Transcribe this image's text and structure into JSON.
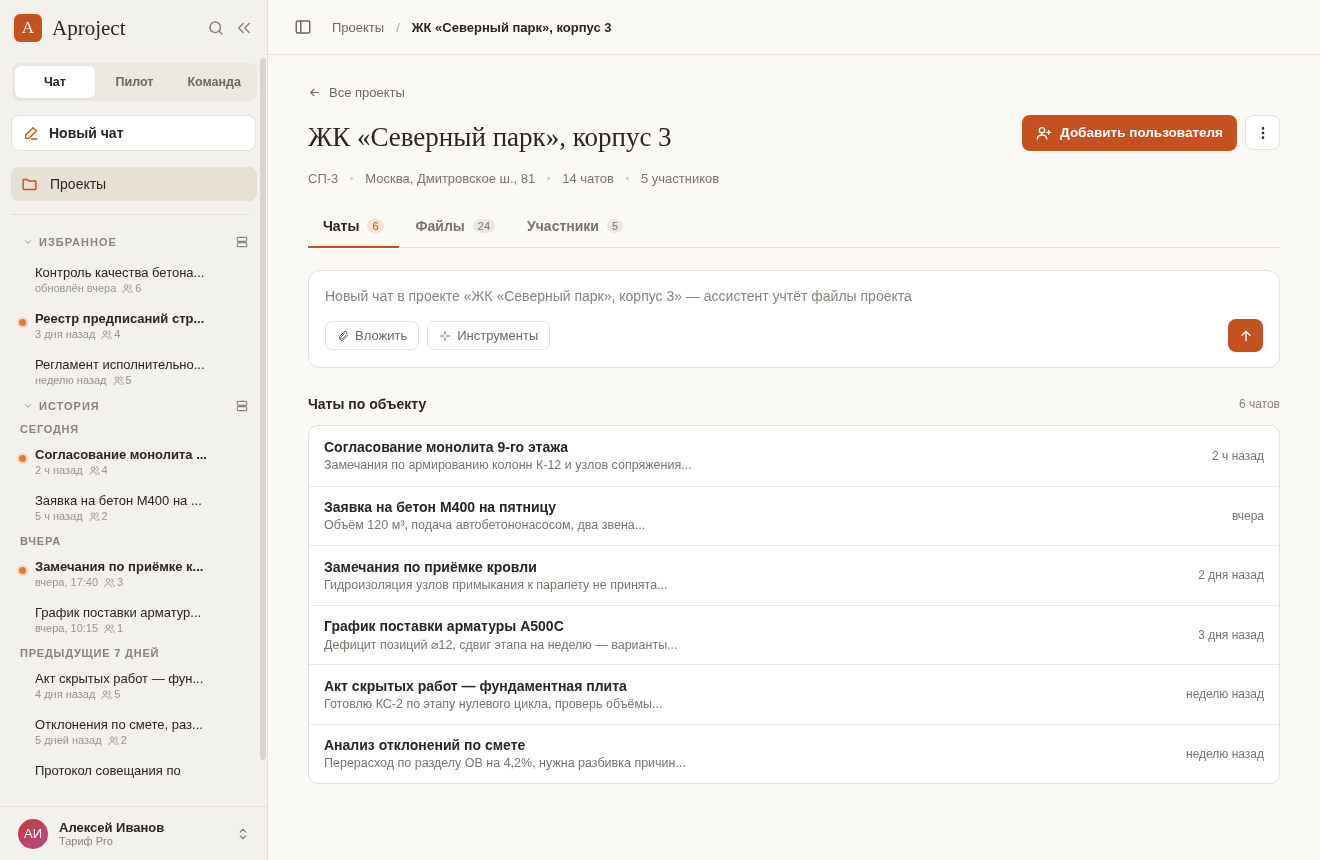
{
  "sidebar": {
    "logo": {
      "letter": "A",
      "name": "Aproject"
    },
    "mode_tabs": [
      {
        "label": "Чат",
        "selected": true
      },
      {
        "label": "Пилот",
        "selected": false
      },
      {
        "label": "Команда",
        "selected": false
      }
    ],
    "new_chat": "Новый чат",
    "nav": [
      {
        "label": "Проекты",
        "selected": true
      }
    ],
    "sections": [
      {
        "title": "ИЗБРАННОЕ",
        "expanded": true,
        "groups": [
          {
            "items": [
              {
                "title": "Контроль качества бетона...",
                "meta": "обновлён вчера",
                "members": "6",
                "unread": false
              },
              {
                "title": "Реестр предписаний стр...",
                "meta": "3 дня назад",
                "members": "4",
                "unread": true
              },
              {
                "title": "Регламент исполнительно...",
                "meta": "неделю назад",
                "members": "5",
                "unread": false
              }
            ]
          }
        ]
      },
      {
        "title": "ИСТОРИЯ",
        "expanded": true,
        "groups": [
          {
            "label": "СЕГОДНЯ",
            "items": [
              {
                "title": "Согласование монолита ...",
                "meta": "2 ч назад",
                "members": "4",
                "unread": true
              },
              {
                "title": "Заявка на бетон М400 на ...",
                "meta": "5 ч назад",
                "members": "2",
                "unread": false
              }
            ]
          },
          {
            "label": "ВЧЕРА",
            "items": [
              {
                "title": "Замечания по приёмке к...",
                "meta": "вчера, 17:40",
                "members": "3",
                "unread": true
              },
              {
                "title": "График поставки арматур...",
                "meta": "вчера, 10:15",
                "members": "1",
                "unread": false
              }
            ]
          },
          {
            "label": "ПРЕДЫДУЩИЕ 7 ДНЕЙ",
            "items": [
              {
                "title": "Акт скрытых работ — фун...",
                "meta": "4 дня назад",
                "members": "5",
                "unread": false
              },
              {
                "title": "Отклонения по смете, раз...",
                "meta": "5 дней назад",
                "members": "2",
                "unread": false
              },
              {
                "title": "Протокол совещания по",
                "unread": false
              }
            ]
          }
        ]
      }
    ],
    "user": {
      "initials": "АИ",
      "name": "Алексей Иванов",
      "plan": "Тариф Pro"
    }
  },
  "breadcrumb": [
    {
      "label": "Проекты",
      "current": false
    },
    {
      "separator": "/",
      "label": "ЖК «Северный парк», корпус 3",
      "current": true
    }
  ],
  "back_link": "Все проекты",
  "title": "ЖК «Северный парк», корпус 3",
  "add_user_button": "Добавить пользователя",
  "meta": [
    "СП-3",
    "Москва, Дмитровское ш., 81",
    "14 чатов",
    "5 участников"
  ],
  "tabs": [
    {
      "label": "Чаты",
      "count": "6",
      "selected": true
    },
    {
      "label": "Файлы",
      "count": "24",
      "selected": false
    },
    {
      "label": "Участники",
      "count": "5",
      "selected": false
    }
  ],
  "composer": {
    "placeholder": "Новый чат в проекте «ЖК «Северный парк», корпус 3» — ассистент учтёт файлы проекта",
    "buttons": [
      {
        "kind": "attach",
        "label": "Вложить"
      },
      {
        "kind": "tools",
        "label": "Инструменты"
      }
    ]
  },
  "chats": {
    "title": "Чаты по объекту",
    "count": "6 чатов",
    "rows": [
      {
        "title": "Согласование монолита 9-го этажа",
        "preview": "Замечания по армированию колонн К-12 и узлов сопряжения...",
        "time": "2 ч назад"
      },
      {
        "title": "Заявка на бетон М400 на пятницу",
        "preview": "Объём 120 м³, подача автобетононасосом, два звена...",
        "time": "вчера"
      },
      {
        "title": "Замечания по приёмке кровли",
        "preview": "Гидроизоляция узлов примыкания к парапету не принята...",
        "time": "2 дня назад"
      },
      {
        "title": "График поставки арматуры А500С",
        "preview": "Дефицит позиций ⌀12, сдвиг этапа на неделю — варианты...",
        "time": "3 дня назад"
      },
      {
        "title": "Акт скрытых работ — фундаментная плита",
        "preview": "Готовлю КС-2 по этапу нулевого цикла, проверь объёмы...",
        "time": "неделю назад"
      },
      {
        "title": "Анализ отклонений по смете",
        "preview": "Перерасход по разделу ОВ на 4,2%, нужна разбивка причин...",
        "time": "неделю назад"
      }
    ]
  }
}
